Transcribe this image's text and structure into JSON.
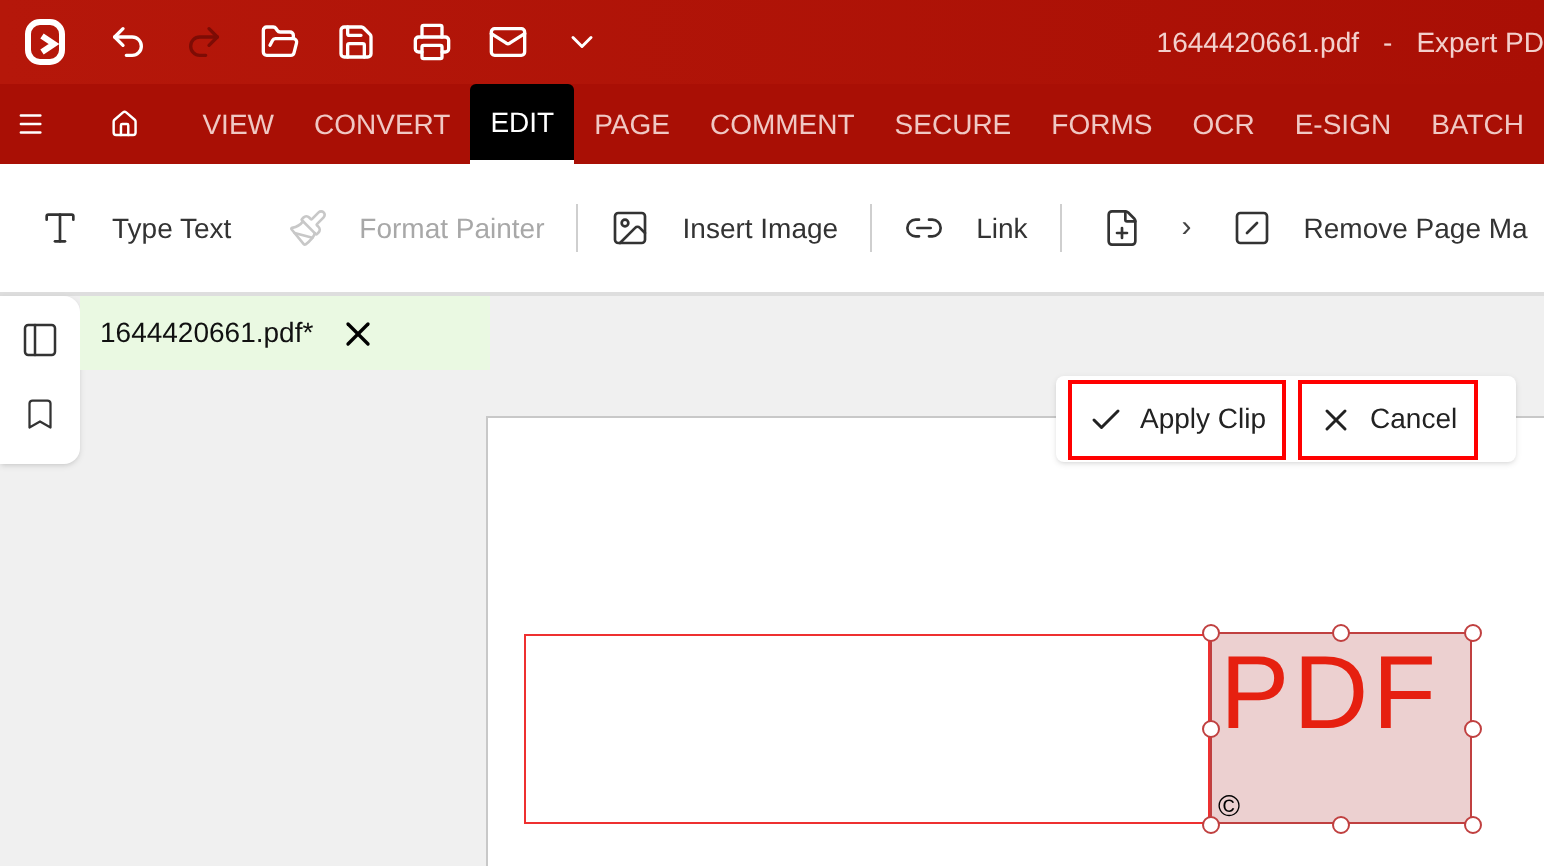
{
  "title_bar": {
    "file_name": "1644420661.pdf",
    "separator": "-",
    "app_name": "Expert PD"
  },
  "menu_tabs": [
    {
      "label": "VIEW",
      "selected": false
    },
    {
      "label": "CONVERT",
      "selected": false
    },
    {
      "label": "EDIT",
      "selected": true
    },
    {
      "label": "PAGE",
      "selected": false
    },
    {
      "label": "COMMENT",
      "selected": false
    },
    {
      "label": "SECURE",
      "selected": false
    },
    {
      "label": "FORMS",
      "selected": false
    },
    {
      "label": "OCR",
      "selected": false
    },
    {
      "label": "E-SIGN",
      "selected": false
    },
    {
      "label": "BATCH",
      "selected": false
    }
  ],
  "toolbar": [
    {
      "kind": "type-text",
      "label": "Type Text",
      "disabled": false
    },
    {
      "kind": "format-painter",
      "label": "Format Painter",
      "disabled": true
    },
    {
      "kind": "insert-image",
      "label": "Insert Image",
      "disabled": false
    },
    {
      "kind": "link",
      "label": "Link",
      "disabled": false
    },
    {
      "kind": "add-page",
      "label": "›",
      "disabled": false
    },
    {
      "kind": "remove-mark",
      "label": "Remove Page Ma",
      "disabled": false
    }
  ],
  "document_tab": {
    "label": "1644420661.pdf*",
    "selected": true
  },
  "clip_actions": [
    {
      "kind": "apply",
      "label": "Apply Clip"
    },
    {
      "kind": "cancel",
      "label": "Cancel"
    }
  ],
  "page": {
    "logo_text": "PDF",
    "copyright": "©"
  }
}
